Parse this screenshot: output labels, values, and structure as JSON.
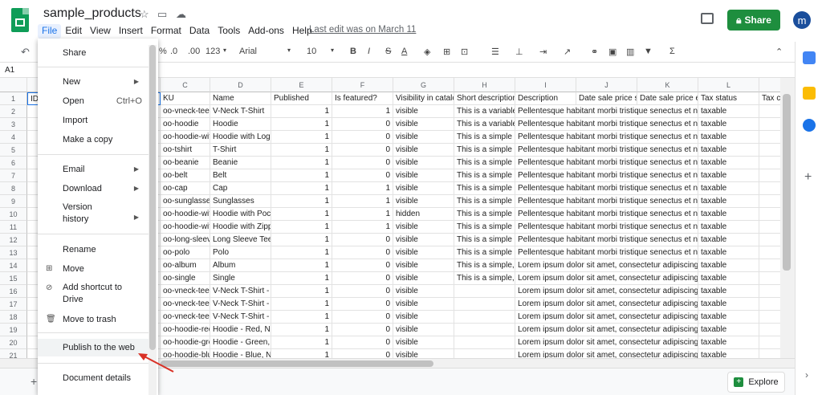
{
  "header": {
    "title": "sample_products",
    "menus": [
      "File",
      "Edit",
      "View",
      "Insert",
      "Format",
      "Data",
      "Tools",
      "Add-ons",
      "Help"
    ],
    "last_edit": "Last edit was on March 11",
    "share_label": "Share",
    "avatar_letter": "m"
  },
  "toolbar": {
    "percent": "%",
    "dec_less": ".0",
    "dec_more": ".00",
    "more_formats": "123",
    "font": "Arial",
    "font_size": "10",
    "bold": "B",
    "italic": "I",
    "strike": "S",
    "text_color": "A",
    "sum": "Σ"
  },
  "formula_bar": {
    "cell_ref": "A1"
  },
  "grid": {
    "col_letters": [
      "C",
      "D",
      "E",
      "F",
      "G",
      "H",
      "I",
      "J",
      "K",
      "L"
    ],
    "row_numbers": [
      "1",
      "2",
      "3",
      "4",
      "5",
      "6",
      "7",
      "8",
      "9",
      "10",
      "11",
      "12",
      "13",
      "14",
      "15",
      "16",
      "17",
      "18",
      "19",
      "20",
      "21"
    ],
    "row1_a": "ID",
    "headers": [
      "KU",
      "Name",
      "Published",
      "Is featured?",
      "Visibility in catalo",
      "Short description",
      "Description",
      "Date sale price s",
      "Date sale price e",
      "Tax status",
      "Tax c"
    ],
    "rows": [
      [
        "oo-vneck-tee",
        "V-Neck T-Shirt",
        "1",
        "1",
        "visible",
        "This is a variable",
        "Pellentesque habitant morbi tristique senectus et ne",
        "taxable"
      ],
      [
        "oo-hoodie",
        "Hoodie",
        "1",
        "0",
        "visible",
        "This is a variable",
        "Pellentesque habitant morbi tristique senectus et ne",
        "taxable"
      ],
      [
        "oo-hoodie-with-",
        "Hoodie with Logo",
        "1",
        "0",
        "visible",
        "This is a simple p",
        "Pellentesque habitant morbi tristique senectus et ne",
        "taxable"
      ],
      [
        "oo-tshirt",
        "T-Shirt",
        "1",
        "0",
        "visible",
        "This is a simple p",
        "Pellentesque habitant morbi tristique senectus et ne",
        "taxable"
      ],
      [
        "oo-beanie",
        "Beanie",
        "1",
        "0",
        "visible",
        "This is a simple p",
        "Pellentesque habitant morbi tristique senectus et ne",
        "taxable"
      ],
      [
        "oo-belt",
        "Belt",
        "1",
        "0",
        "visible",
        "This is a simple p",
        "Pellentesque habitant morbi tristique senectus et ne",
        "taxable"
      ],
      [
        "oo-cap",
        "Cap",
        "1",
        "1",
        "visible",
        "This is a simple p",
        "Pellentesque habitant morbi tristique senectus et ne",
        "taxable"
      ],
      [
        "oo-sunglasses",
        "Sunglasses",
        "1",
        "1",
        "visible",
        "This is a simple p",
        "Pellentesque habitant morbi tristique senectus et ne",
        "taxable"
      ],
      [
        "oo-hoodie-with-",
        "Hoodie with Pock",
        "1",
        "1",
        "hidden",
        "This is a simple p",
        "Pellentesque habitant morbi tristique senectus et ne",
        "taxable"
      ],
      [
        "oo-hoodie-with-",
        "Hoodie with Zipp",
        "1",
        "1",
        "visible",
        "This is a simple p",
        "Pellentesque habitant morbi tristique senectus et ne",
        "taxable"
      ],
      [
        "oo-long-sleeve-t",
        "Long Sleeve Tee",
        "1",
        "0",
        "visible",
        "This is a simple p",
        "Pellentesque habitant morbi tristique senectus et ne",
        "taxable"
      ],
      [
        "oo-polo",
        "Polo",
        "1",
        "0",
        "visible",
        "This is a simple p",
        "Pellentesque habitant morbi tristique senectus et ne",
        "taxable"
      ],
      [
        "oo-album",
        "Album",
        "1",
        "0",
        "visible",
        "This is a simple,",
        "Lorem ipsum dolor sit amet, consectetur adipiscing",
        "taxable"
      ],
      [
        "oo-single",
        "Single",
        "1",
        "0",
        "visible",
        "This is a simple,",
        "Lorem ipsum dolor sit amet, consectetur adipiscing",
        "taxable"
      ],
      [
        "oo-vneck-tee-re",
        "V-Neck T-Shirt - I",
        "1",
        "0",
        "visible",
        "",
        "Lorem ipsum dolor sit amet, consectetur adipiscing",
        "taxable"
      ],
      [
        "oo-vneck-tee-gr",
        "V-Neck T-Shirt - (",
        "1",
        "0",
        "visible",
        "",
        "Lorem ipsum dolor sit amet, consectetur adipiscing",
        "taxable"
      ],
      [
        "oo-vneck-tee-bl",
        "V-Neck T-Shirt - I",
        "1",
        "0",
        "visible",
        "",
        "Lorem ipsum dolor sit amet, consectetur adipiscing",
        "taxable"
      ],
      [
        "oo-hoodie-red",
        "Hoodie - Red, Nc",
        "1",
        "0",
        "visible",
        "",
        "Lorem ipsum dolor sit amet, consectetur adipiscing",
        "taxable"
      ],
      [
        "oo-hoodie-green",
        "Hoodie - Green, I",
        "1",
        "0",
        "visible",
        "",
        "Lorem ipsum dolor sit amet, consectetur adipiscing",
        "taxable"
      ],
      [
        "oo-hoodie-blue",
        "Hoodie - Blue, Nc",
        "1",
        "0",
        "visible",
        "",
        "Lorem ipsum dolor sit amet, consectetur adipiscing",
        "taxable"
      ]
    ]
  },
  "file_menu": {
    "share": "Share",
    "new": "New",
    "open": "Open",
    "open_shortcut": "Ctrl+O",
    "import": "Import",
    "make_copy": "Make a copy",
    "email": "Email",
    "download": "Download",
    "version_history_1": "Version",
    "version_history_2": "history",
    "rename": "Rename",
    "move": "Move",
    "add_shortcut_1": "Add shortcut to",
    "add_shortcut_2": "Drive",
    "move_trash": "Move to trash",
    "publish": "Publish to the web",
    "doc_details": "Document details"
  },
  "bottom": {
    "explore_label": "Explore"
  },
  "colors": {
    "share_green": "#1e8e3e",
    "accent_blue": "#1a73e8",
    "arrow_red": "#d93025"
  }
}
